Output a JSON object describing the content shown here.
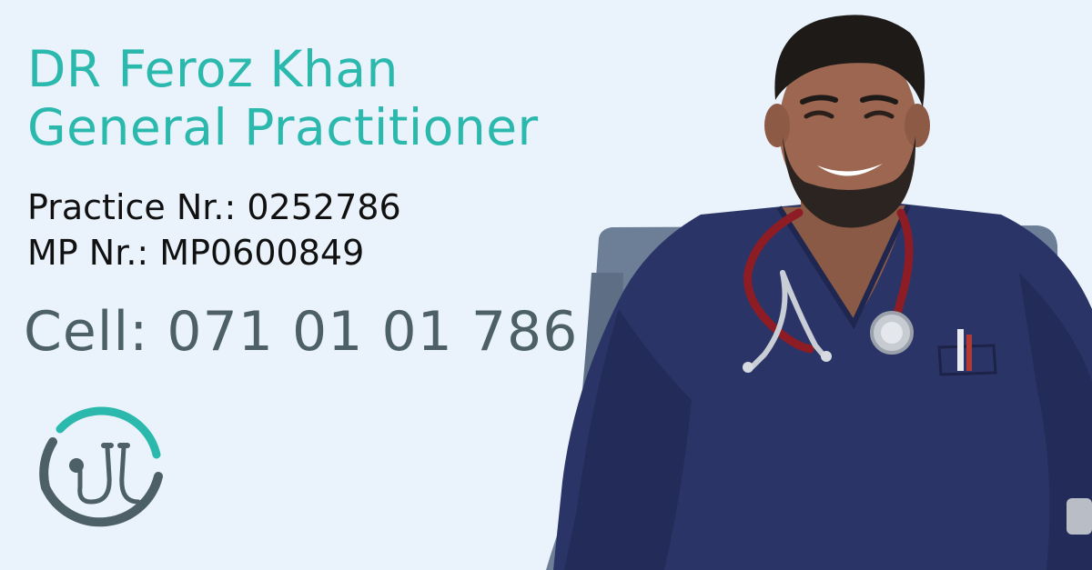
{
  "header": {
    "name": "DR Feroz Khan",
    "title": "General Practitioner"
  },
  "registration": {
    "practice": "Practice Nr.: 0252786",
    "mp": "MP Nr.: MP0600849"
  },
  "contact": {
    "cell": "Cell: 071 01 01 786"
  },
  "icons": {
    "logo": "stethoscope-icon"
  },
  "colors": {
    "accent": "#2bb8ad",
    "phone": "#4d5f67",
    "background": "#eaf3fc",
    "scrubs": "#2b3466"
  }
}
